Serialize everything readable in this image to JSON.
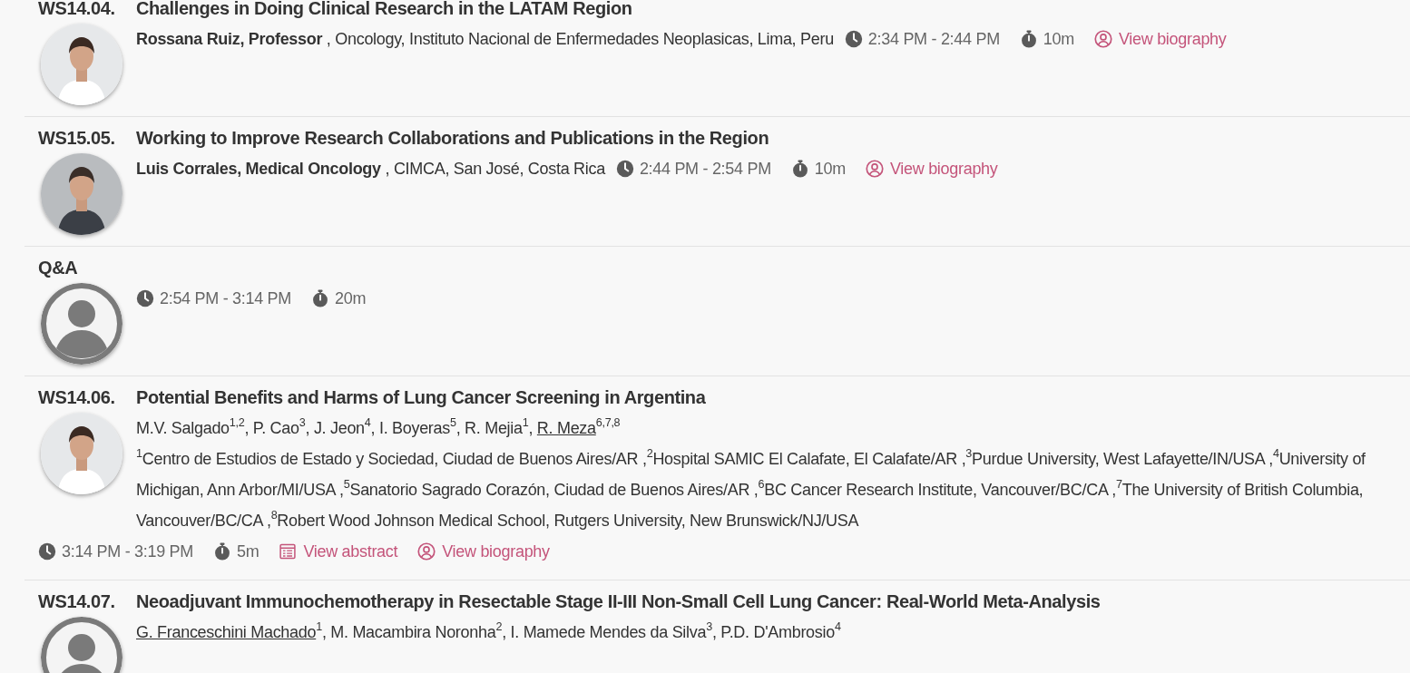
{
  "sessions": [
    {
      "code": "WS14.04.",
      "title": "Challenges in Doing Clinical Research in the LATAM Region",
      "avatar": {
        "kind": "picture"
      },
      "speaker": "Rossana Ruiz, Professor",
      "affiliation": " , Oncology, Instituto Nacional de Enfermedades Neoplasicas, Lima, Peru",
      "time": "2:34 PM - 2:44 PM",
      "duration": "10m",
      "links": [
        {
          "kind": "biography",
          "label": "View biography"
        }
      ]
    },
    {
      "code": "WS15.05.",
      "title": "Working to Improve Research Collaborations and Publications in the Region",
      "avatar": {
        "kind": "picture"
      },
      "speaker": "Luis Corrales, Medical Oncology",
      "affiliation": " , CIMCA, San José, Costa Rica",
      "time": "2:44 PM - 2:54 PM",
      "duration": "10m",
      "links": [
        {
          "kind": "biography",
          "label": "View biography"
        }
      ]
    },
    {
      "code": "Q&A",
      "avatar": {
        "kind": "placeholder"
      },
      "time": "2:54 PM - 3:14 PM",
      "duration": "20m"
    },
    {
      "code": "WS14.06.",
      "title": "Potential Benefits and Harms of Lung Cancer Screening in Argentina",
      "avatar": {
        "kind": "picture"
      },
      "authors": [
        {
          "name": "M.V. Salgado",
          "sup": "1,2",
          "presenter": false
        },
        {
          "prefix": ", ",
          "name": "P. Cao",
          "sup": "3",
          "presenter": false
        },
        {
          "prefix": ", ",
          "name": "J. Jeon",
          "sup": "4",
          "presenter": false
        },
        {
          "prefix": ", ",
          "name": "I. Boyeras",
          "sup": "5",
          "presenter": false
        },
        {
          "prefix": ", ",
          "name": "R. Mejia",
          "sup": "1",
          "presenter": false
        },
        {
          "prefix": ", ",
          "name": "R. Meza",
          "sup": "6,7,8",
          "presenter": true
        }
      ],
      "affiliations": "$^{1}$Centro de Estudios de Estado y Sociedad, Ciudad de Buenos Aires/AR ,$^{2}$Hospital SAMIC El Calafate, El Calafate/AR ,$^{3}$Purdue University, West Lafayette/IN/USA ,$^{4}$University of Michigan, Ann Arbor/MI/USA ,$^{5}$Sanatorio Sagrado Corazón, Ciudad de Buenos Aires/AR ,$^{6}$BC Cancer Research Institute, Vancouver/BC/CA ,$^{7}$The University of British Columbia, Vancouver/BC/CA ,$^{8}$Robert Wood Johnson Medical School, Rutgers University, New Brunswick/NJ/USA",
      "time": "3:14 PM - 3:19 PM",
      "duration": "5m",
      "links": [
        {
          "kind": "abstract",
          "label": "View abstract"
        },
        {
          "kind": "biography",
          "label": "View biography"
        }
      ]
    },
    {
      "code": "WS14.07.",
      "title": "Neoadjuvant Immunochemotherapy in Resectable Stage II-III Non-Small Cell Lung Cancer: Real-World Meta-Analysis",
      "avatar": {
        "kind": "placeholder"
      },
      "authors": [
        {
          "name": "G. Franceschini Machado",
          "sup": "1",
          "presenter": true
        },
        {
          "prefix": ", ",
          "name": "M. Macambira Noronha",
          "sup": "2",
          "presenter": false
        },
        {
          "prefix": ", ",
          "name": "I. Mamede Mendes da Silva",
          "sup": "3",
          "presenter": false
        },
        {
          "prefix": ", ",
          "name": "P.D. D'Ambrosio",
          "sup": "4",
          "presenter": false
        }
      ]
    }
  ]
}
